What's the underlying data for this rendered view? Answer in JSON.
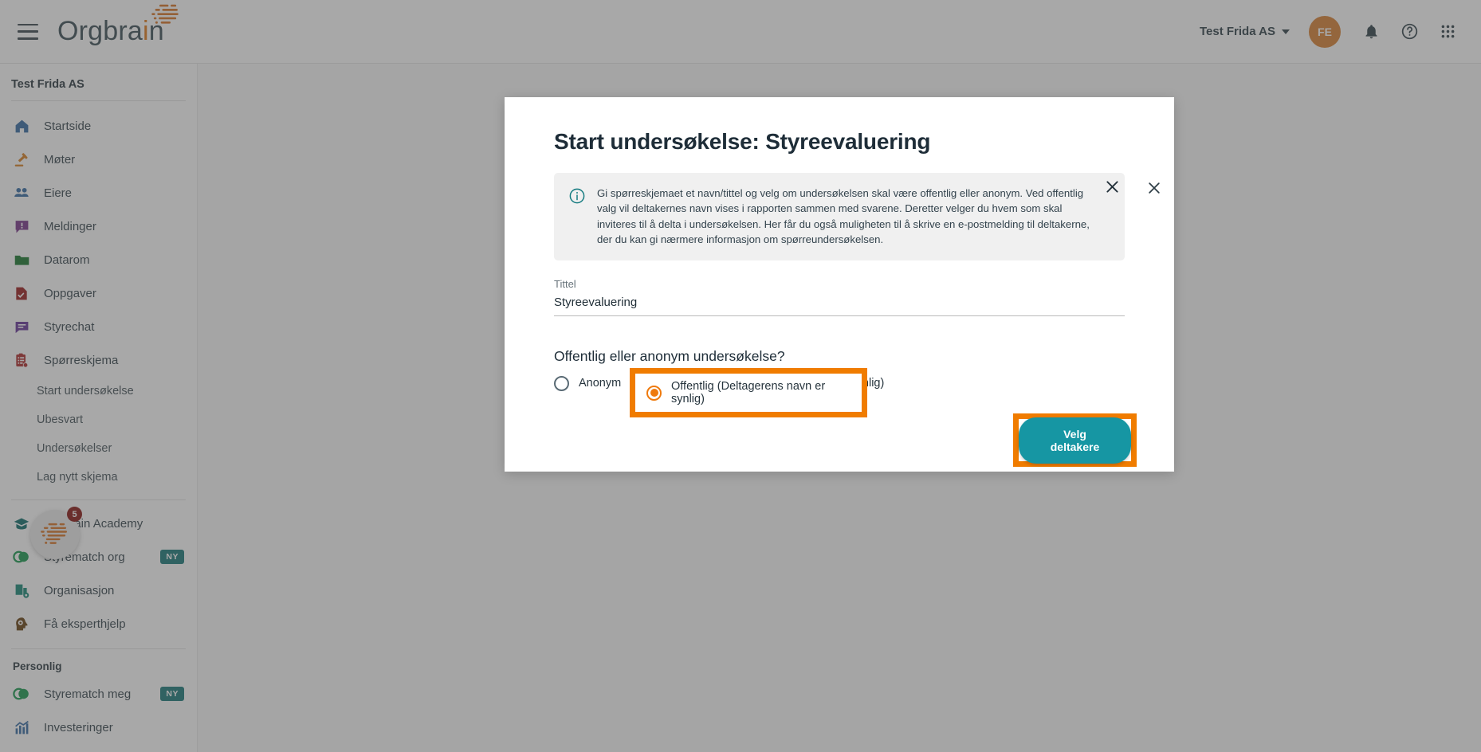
{
  "topbar": {
    "brand_name_part1": "Orgbra",
    "brand_name_accent": "i",
    "brand_name_part3": "n",
    "brand_full": "Orgbrain",
    "org_switch_label": "Test Frida AS",
    "avatar_initials": "FE"
  },
  "sidebar": {
    "org_name": "Test Frida AS",
    "items": [
      {
        "label": "Startside",
        "icon": "home-icon",
        "color": "#3a6ea5"
      },
      {
        "label": "Møter",
        "icon": "gavel-icon",
        "color": "#d98226"
      },
      {
        "label": "Eiere",
        "icon": "people-icon",
        "color": "#3a6ea5"
      },
      {
        "label": "Meldinger",
        "icon": "message-alert-icon",
        "color": "#7c3a8c"
      },
      {
        "label": "Datarom",
        "icon": "folder-icon",
        "color": "#1d7a31"
      },
      {
        "label": "Oppgaver",
        "icon": "task-document-icon",
        "color": "#9b2020"
      },
      {
        "label": "Styrechat",
        "icon": "chat-icon",
        "color": "#6a3a9b"
      },
      {
        "label": "Spørreskjema",
        "icon": "clipboard-check-icon",
        "color": "#b03030"
      }
    ],
    "sub_items": [
      {
        "label": "Start undersøkelse"
      },
      {
        "label": "Ubesvart"
      },
      {
        "label": "Undersøkelser"
      },
      {
        "label": "Lag nytt skjema"
      }
    ],
    "items_group2": [
      {
        "label": "Orgbrain Academy",
        "icon": "graduation-cap-icon",
        "color": "#13706e",
        "badge": ""
      },
      {
        "label": "Styrematch org",
        "icon": "venn-circles-icon",
        "color": "#1d9b52",
        "badge": "NY"
      },
      {
        "label": "Organisasjon",
        "icon": "org-building-icon",
        "color": "#1d8a7a",
        "badge": ""
      },
      {
        "label": "Få eksperthjelp",
        "icon": "head-gear-icon",
        "color": "#6b4516",
        "badge": ""
      }
    ],
    "personal_section_title": "Personlig",
    "items_personal": [
      {
        "label": "Styrematch meg",
        "icon": "venn-circles-icon",
        "color": "#1d9b52",
        "badge": "NY"
      },
      {
        "label": "Investeringer",
        "icon": "chart-up-icon",
        "color": "#3a6ea5",
        "badge": ""
      }
    ],
    "chat_badge_count": "5"
  },
  "dialog": {
    "title": "Start undersøkelse: Styreevaluering",
    "info_text": "Gi spørreskjemaet et navn/tittel og velg om undersøkelsen skal være offentlig eller anonym. Ved offentlig valg vil deltakernes navn vises i rapporten sammen med svarene. Deretter velger du hvem som skal inviteres til å delta i undersøkelsen. Her får du også muligheten til å skrive en e-postmelding til deltakerne, der du kan gi nærmere informasjon om spørreundersøkelsen.",
    "title_field_label": "Tittel",
    "title_field_value": "Styreevaluering",
    "title_field_placeholder": "Tittel",
    "question_label": "Offentlig eller anonym undersøkelse?",
    "radio_anonymous_label": "Anonym",
    "radio_public_label": "Offentlig (Deltagerens navn er synlig)",
    "selected_option": "Offentlig (Deltagerens navn er synlig)",
    "cta_label": "Velg deltakere"
  },
  "colors": {
    "highlight": "#f07c00",
    "cta_bg": "#1696a3",
    "brand_accent": "#e07c1e",
    "badge_ny": "#1d7b7b"
  }
}
